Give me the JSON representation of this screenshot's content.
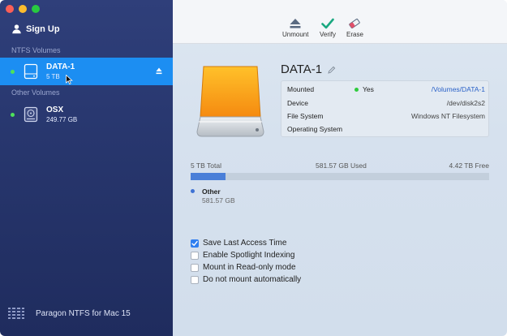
{
  "sidebar": {
    "sign_up_label": "Sign Up",
    "sections": [
      {
        "title": "NTFS Volumes",
        "items": [
          {
            "name": "DATA-1",
            "size": "5 TB",
            "mounted": true,
            "selected": true
          }
        ]
      },
      {
        "title": "Other Volumes",
        "items": [
          {
            "name": "OSX",
            "size": "249.77 GB",
            "mounted": true,
            "selected": false
          }
        ]
      }
    ],
    "app_name": "Paragon NTFS for Mac 15"
  },
  "toolbar": {
    "unmount_label": "Unmount",
    "verify_label": "Verify",
    "erase_label": "Erase"
  },
  "volume": {
    "title": "DATA-1",
    "info": {
      "mounted_label": "Mounted",
      "mounted_value": "Yes",
      "mount_path": "/Volumes/DATA-1",
      "device_label": "Device",
      "device_value": "/dev/disk2s2",
      "fs_label": "File System",
      "fs_value": "Windows NT Filesystem",
      "os_label": "Operating System",
      "os_value": ""
    },
    "capacity": {
      "total_text": "5 TB Total",
      "used_text": "581.57 GB Used",
      "free_text": "4.42 TB Free",
      "used_fraction": 0.116
    },
    "legend": {
      "name": "Other",
      "size": "581.57 GB"
    }
  },
  "options": [
    {
      "label": "Save Last Access Time",
      "checked": true
    },
    {
      "label": "Enable Spotlight Indexing",
      "checked": false
    },
    {
      "label": "Mount in Read-only mode",
      "checked": false
    },
    {
      "label": "Do not mount automatically",
      "checked": false
    }
  ],
  "colors": {
    "sidebar_bg": "#27366d",
    "selection": "#1c8ef2",
    "mounted_dot": "#4ee25a",
    "accent": "#2f7ff0",
    "capacity_fill": "#4a7fd8",
    "disk_orange": "#f59a12"
  },
  "icons": {
    "sign_up": "person-icon",
    "volume": "hard-drive-icon",
    "eject": "eject-icon",
    "unmount": "eject-icon",
    "verify": "checkmark-icon",
    "erase": "eraser-icon",
    "edit": "pencil-icon",
    "brand": "paragon-logo-icon"
  }
}
